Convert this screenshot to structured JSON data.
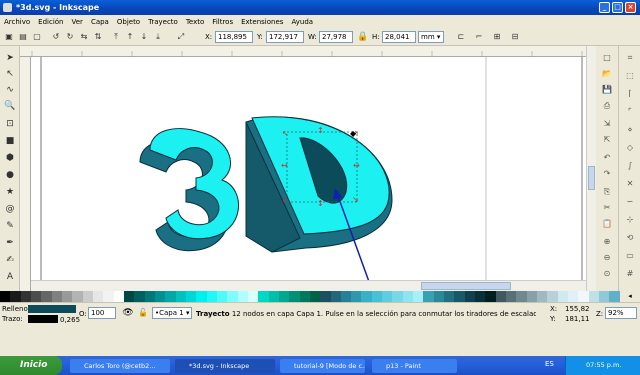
{
  "window": {
    "title": "*3d.svg - Inkscape",
    "minimize": "_",
    "maximize": "□",
    "close": "×"
  },
  "menu": [
    "Archivo",
    "Edición",
    "Ver",
    "Capa",
    "Objeto",
    "Trayecto",
    "Texto",
    "Filtros",
    "Extensiones",
    "Ayuda"
  ],
  "toolbar": {
    "x_label": "X:",
    "x_value": "118,895",
    "y_label": "Y:",
    "y_value": "172,917",
    "w_label": "W:",
    "w_value": "27,978",
    "h_label": "H:",
    "h_value": "28,041",
    "unit": "mm"
  },
  "statusbar": {
    "fill_label": "Relleno:",
    "stroke_label": "Trazo:",
    "stroke_width": "0,265",
    "opacity_label": "O:",
    "opacity_value": "100",
    "layer": "•Capa 1",
    "message_strong": "Trayecto",
    "message": "12 nodos en capa Capa 1. Pulse en la selección para conmutar los tiradores de escalado/rotación.",
    "x_label": "X:",
    "x_value": "155,82",
    "y_label": "Y:",
    "y_value": "181,11",
    "zoom_label": "Z:",
    "zoom_value": "92%"
  },
  "taskbar": {
    "start": "Inicio",
    "tasks": [
      "Carlos Toro (@cetb2...",
      "*3d.svg - Inkscape",
      "tutorial-9 [Modo de c...",
      "p13 - Paint"
    ],
    "lang": "ES",
    "clock": "07:55 p.m."
  },
  "colors": {
    "fill": "#1cf0f0",
    "dark_side": "#1a6f82",
    "selection_path": "#007878",
    "arrow": "#1020b0"
  },
  "palette": [
    "#000000",
    "#1a1a1a",
    "#333333",
    "#4d4d4d",
    "#666666",
    "#808080",
    "#999999",
    "#b3b3b3",
    "#cccccc",
    "#e6e6e6",
    "#f2f2f2",
    "#ffffff",
    "#004848",
    "#006060",
    "#007878",
    "#009090",
    "#00a8a8",
    "#00c0c0",
    "#00d8d8",
    "#00f0f0",
    "#20f8f8",
    "#50fafa",
    "#80fcfc",
    "#b0fdfd",
    "#d8fefe",
    "#00d8c0",
    "#00c0a8",
    "#00a890",
    "#009078",
    "#007860",
    "#006048",
    "#1a5060",
    "#20687a",
    "#288094",
    "#3098ae",
    "#38b0c8",
    "#48c0d8",
    "#60cce0",
    "#78d8e8",
    "#90e4f0",
    "#a8f0f8",
    "#38a0b0",
    "#2a8898",
    "#207080",
    "#185868",
    "#104050",
    "#083038",
    "#002020",
    "#405860",
    "#587078",
    "#708890",
    "#88a0a8",
    "#a0b8c0",
    "#b8d0d8",
    "#d0e8f0",
    "#e0f0f8",
    "#f0f8fc",
    "#c0e0e8",
    "#90c8d8",
    "#60b0c8"
  ]
}
